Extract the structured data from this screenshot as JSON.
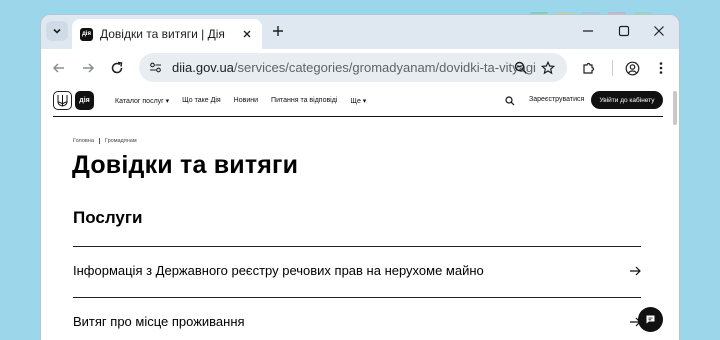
{
  "browser": {
    "tab": {
      "favicon_text": "дія",
      "title": "Довідки та витяги | Дія"
    },
    "url": {
      "host": "diia.gov.ua",
      "path": "/services/categories/gromadyanam/dovidki-ta-vityagi"
    }
  },
  "header": {
    "logo_text": "дія",
    "nav": [
      "Каталог послуг ▾",
      "Що таке Дія",
      "Новини",
      "Питання та відповіді",
      "Ще ▾"
    ],
    "register": "Зареєструватися",
    "cabinet": "Увійти до кабінету"
  },
  "breadcrumb": [
    "Головна",
    "Громадянам"
  ],
  "page_title": "Довідки та витяги",
  "section_title": "Послуги",
  "services": [
    {
      "label": "Інформація з Державного реєстру речових прав на нерухоме майно"
    },
    {
      "label": "Витяг про місце проживання"
    }
  ],
  "colors": {
    "desktop": "#9bd6ea",
    "accent": "#111111"
  }
}
